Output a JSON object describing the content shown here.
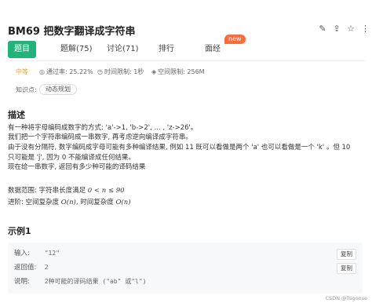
{
  "problem": {
    "title": "BM69  把数字翻译成字符串",
    "toolbar_icons": [
      "edit-icon",
      "share-icon",
      "star-icon",
      "more-icon"
    ]
  },
  "tabs": [
    {
      "label": "题目",
      "active": true
    },
    {
      "label": "题解(75)"
    },
    {
      "label": "讨论(71)"
    },
    {
      "label": "排行"
    },
    {
      "label": "面经"
    }
  ],
  "new_badge": "new",
  "meta": {
    "difficulty": "中等",
    "pass_rate": "通过率: 25.22%",
    "time_limit": "时间限制: 1秒",
    "space_limit": "空间限制: 256M"
  },
  "knowledge": {
    "label": "知识点:",
    "tag": "动态规划"
  },
  "description": {
    "heading": "描述",
    "line1": "有一种将字母编码成数字的方式: 'a'->1, 'b->2', ... , 'z->26'。",
    "line2": "我们把一个字符串编码成一串数字, 再考虑逆向编译成字符串。",
    "line3": "由于没有分隔符, 数字编码成字母可能有多种编译结果, 例如 11 既可以看做是两个 'a' 也可以看做是一个 'k' 。但 10",
    "line4": "只可能是 'j', 因为 0 不能编译成任何结果。",
    "line5": "现在给一串数字, 返回有多少种可能的译码结果",
    "range_prefix": "数据范围: 字符串长度满足 ",
    "range_math": "0 < n ≤ 90",
    "adv_prefix": "进阶: 空间复杂度 ",
    "adv_math1": "O(n)",
    "adv_mid": ", 时间复杂度 ",
    "adv_math2": "O(n)"
  },
  "example": {
    "heading": "示例1",
    "input_label": "输入:",
    "input_value": "\"12\"",
    "output_label": "返回值:",
    "output_value": "2",
    "explain_label": "说明:",
    "explain_value": "2种可能的译码结果 (\"ab\" 或\"l\")",
    "copy_label": "复制"
  },
  "footer": "CSDN @llsgoose"
}
